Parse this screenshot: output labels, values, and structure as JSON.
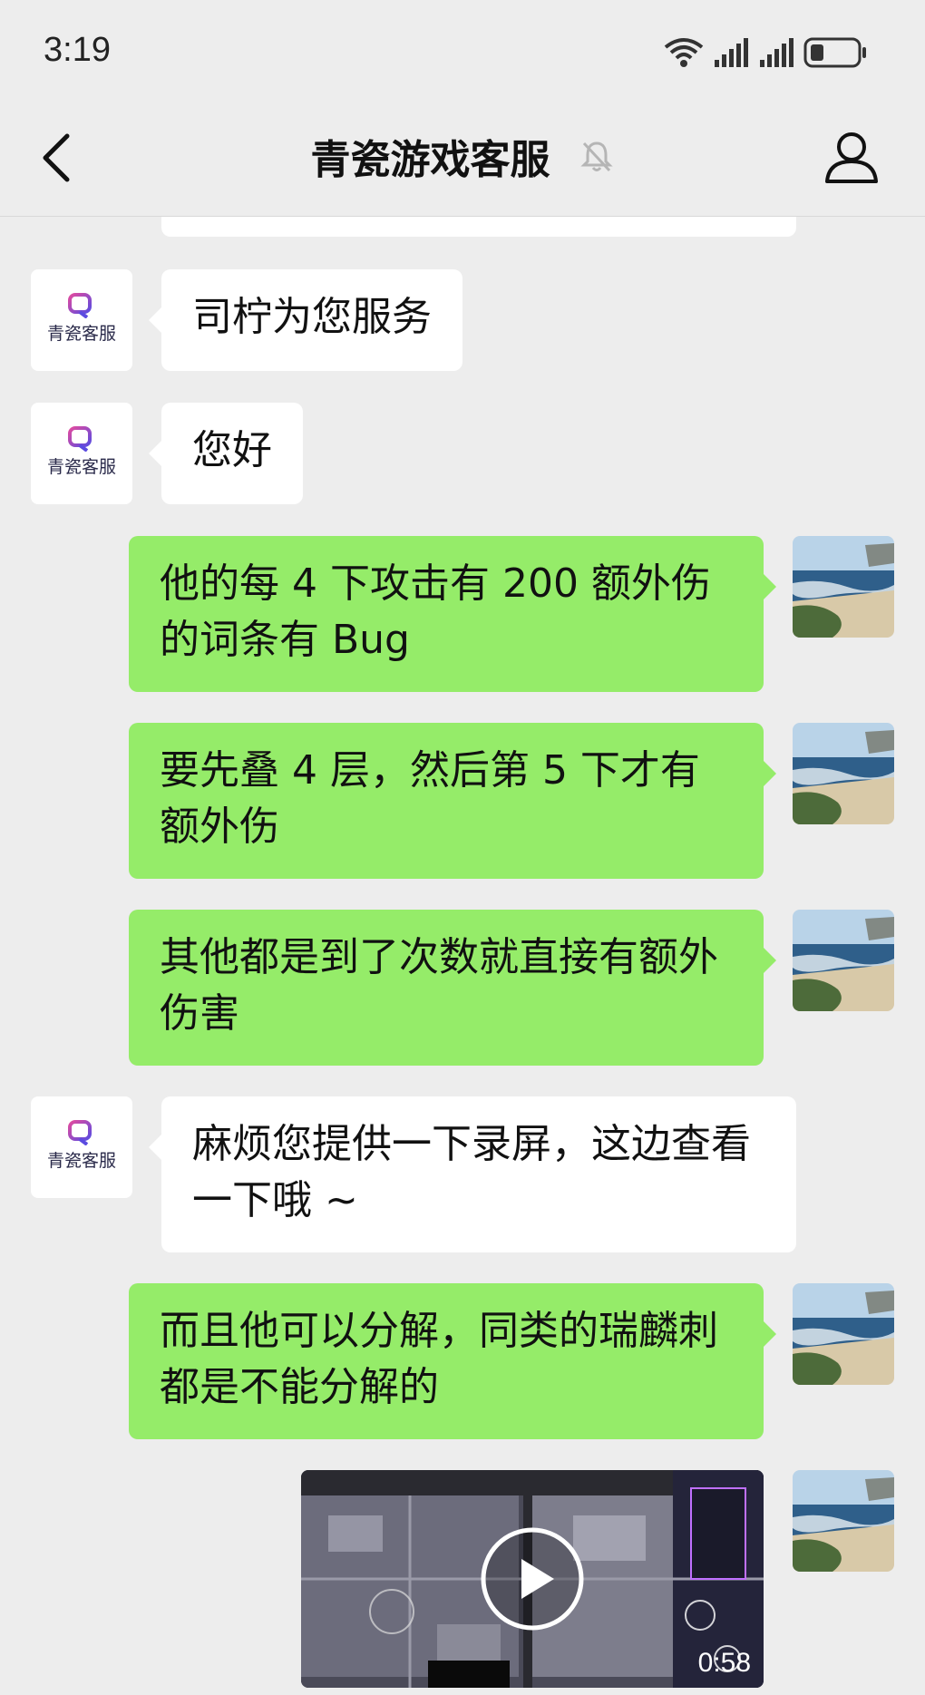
{
  "status": {
    "time": "3:19"
  },
  "header": {
    "title": "青瓷游戏客服"
  },
  "support_avatar": {
    "text": "青瓷客服",
    "accent_color": "#7b3fe4"
  },
  "colors": {
    "outgoing_bubble": "#95ec69",
    "incoming_bubble": "#ffffff",
    "background": "#ededed"
  },
  "messages": [
    {
      "from": "support",
      "text": "司柠为您服务"
    },
    {
      "from": "support",
      "text": "您好"
    },
    {
      "from": "user",
      "text": "他的每 4 下攻击有 200 额外伤的词条有 Bug"
    },
    {
      "from": "user",
      "text": "要先叠 4 层，然后第 5 下才有额外伤"
    },
    {
      "from": "user",
      "text": "其他都是到了次数就直接有额外伤害"
    },
    {
      "from": "support",
      "text": "麻烦您提供一下录屏，这边查看一下哦 ~"
    },
    {
      "from": "user",
      "text": "而且他可以分解，同类的瑞麟刺都是不能分解的"
    },
    {
      "from": "user",
      "type": "video",
      "duration": "0:58",
      "icon": "play-icon"
    }
  ]
}
